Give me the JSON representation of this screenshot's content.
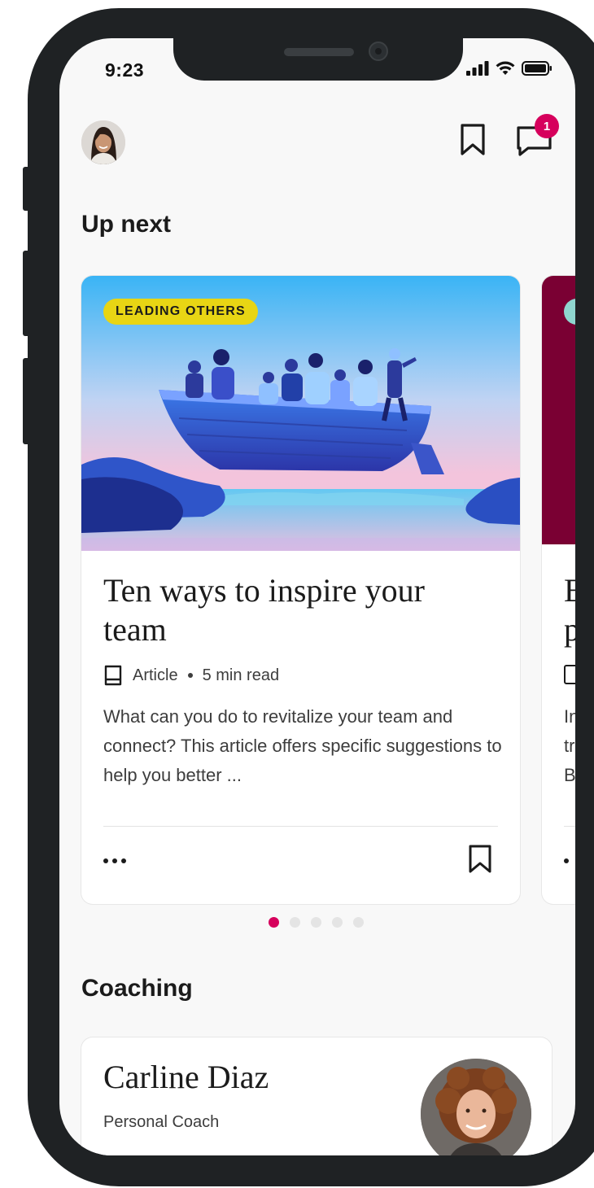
{
  "status_bar": {
    "time": "9:23"
  },
  "header": {
    "avatar_icon": "user-avatar",
    "bookmark_icon": "bookmark-icon",
    "messages_icon": "chat-icon",
    "messages_badge": "1"
  },
  "up_next": {
    "title": "Up next",
    "cards": [
      {
        "tag": "LEADING OTHERS",
        "title": "Ten ways to inspire your team",
        "type": "Article",
        "duration": "5 min read",
        "description": "What can you do to revitalize your team and connect? This article offers specific suggestions to help you better ...",
        "image_icon": "boat-illustration"
      },
      {
        "title": "E\np",
        "description": "In\ntr\nB"
      }
    ],
    "pager": {
      "count": 5,
      "active": 1
    }
  },
  "coaching": {
    "title": "Coaching",
    "coach": {
      "name": "Carline Diaz",
      "role": "Personal Coach"
    }
  },
  "colors": {
    "accent": "#d6005c",
    "tag_yellow": "#e8d514",
    "card2_bg": "#7a0033"
  }
}
